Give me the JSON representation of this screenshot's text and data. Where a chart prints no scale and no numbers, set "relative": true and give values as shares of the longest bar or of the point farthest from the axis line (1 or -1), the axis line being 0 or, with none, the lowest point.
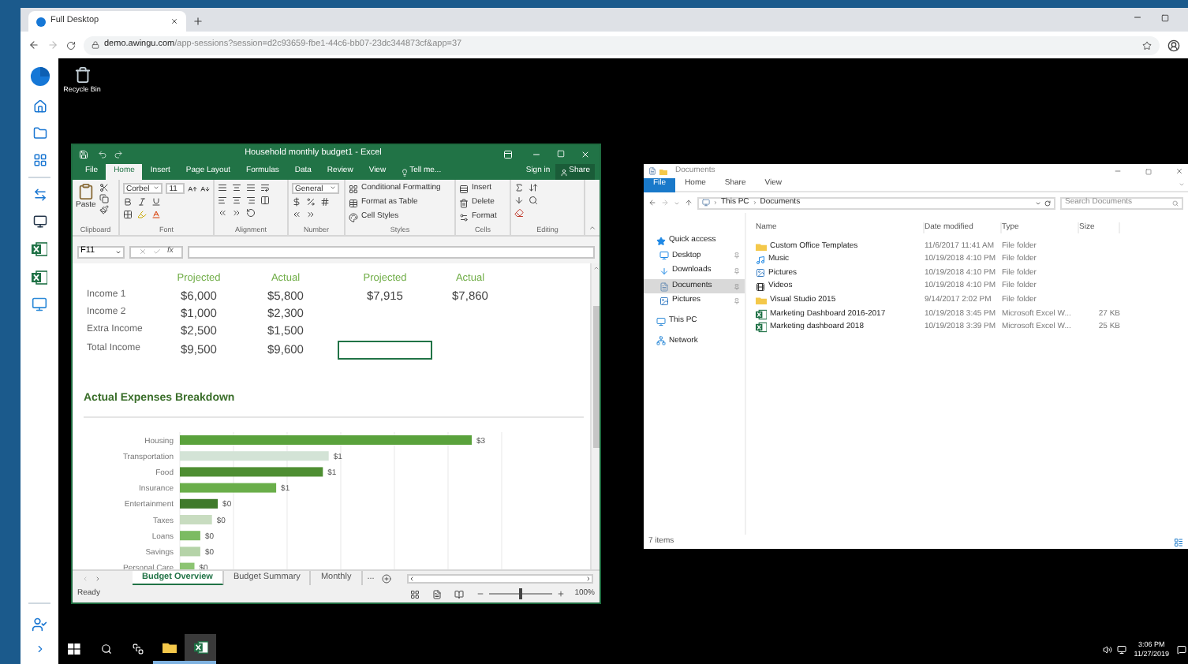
{
  "browser": {
    "tab": {
      "title": "Full Desktop",
      "selected": true
    },
    "url_domain": "demo.awingu.com",
    "url_path": "/app-sessions?session=d2c93659-fbe1-44c6-bb07-23dc344873cf&app=37"
  },
  "desktop": {
    "icons": [
      {
        "label": "Recycle Bin"
      }
    ]
  },
  "excel": {
    "title": "Household monthly budget1 - Excel",
    "tabs": [
      {
        "label": "File",
        "selected": false
      },
      {
        "label": "Home",
        "selected": true
      },
      {
        "label": "Insert",
        "selected": false
      },
      {
        "label": "Page Layout",
        "selected": false
      },
      {
        "label": "Formulas",
        "selected": false
      },
      {
        "label": "Data",
        "selected": false
      },
      {
        "label": "Review",
        "selected": false
      },
      {
        "label": "View",
        "selected": false
      }
    ],
    "tell_me": "Tell me...",
    "sign_in": "Sign in",
    "share": "Share",
    "ribbon": {
      "paste": "Paste",
      "font_name": "Corbel",
      "font_size": "11",
      "number_format": "General",
      "styles": [
        "Conditional Formatting",
        "Format as Table",
        "Cell Styles"
      ],
      "cells": [
        "Insert",
        "Delete",
        "Format"
      ],
      "groups": [
        "Clipboard",
        "Font",
        "Alignment",
        "Number",
        "Styles",
        "Cells",
        "Editing"
      ]
    },
    "name_box": "F11",
    "fx": "fx",
    "sheet": {
      "headers": [
        "Projected",
        "Actual",
        "Projected",
        "Actual"
      ],
      "rows": [
        {
          "label": "Income 1",
          "cells": [
            "$6,000",
            "$5,800",
            "$7,915",
            "$7,860"
          ]
        },
        {
          "label": "Income 2",
          "cells": [
            "$1,000",
            "$2,300"
          ]
        },
        {
          "label": "Extra Income",
          "cells": [
            "$2,500",
            "$1,500"
          ]
        },
        {
          "label": "Total Income",
          "cells": [
            "$9,500",
            "$9,600"
          ]
        }
      ],
      "section_title": "Actual Expenses Breakdown",
      "chart_data": {
        "type": "bar",
        "orientation": "horizontal",
        "relative": true,
        "categories": [
          "Housing",
          "Transportation",
          "Food",
          "Insurance",
          "Entertainment",
          "Taxes",
          "Loans",
          "Savings",
          "Personal Care"
        ],
        "series": [
          {
            "values": [
              1,
              0.51,
              0.49,
              0.33,
              0.13,
              0.11,
              0.07,
              0.07,
              0.05
            ]
          }
        ],
        "value_labels": [
          "$3",
          "$1",
          "$1",
          "$1",
          "$0",
          "$0",
          "$0",
          "$0",
          "$0"
        ]
      }
    },
    "sheet_tabs": [
      {
        "label": "Budget Overview",
        "selected": true
      },
      {
        "label": "Budget Summary",
        "selected": false
      },
      {
        "label": "Monthly",
        "selected": false
      }
    ],
    "more_tabs": "...",
    "status": "Ready",
    "zoom": {
      "level": 0.5,
      "reading": "100%"
    }
  },
  "explorer": {
    "title": "Documents",
    "tabs": [
      {
        "label": "File",
        "selected": true
      },
      {
        "label": "Home",
        "selected": false
      },
      {
        "label": "Share",
        "selected": false
      },
      {
        "label": "View",
        "selected": false
      }
    ],
    "breadcrumb": [
      "This PC",
      "Documents"
    ],
    "search": {
      "placeholder": "Search Documents"
    },
    "nav": [
      {
        "label": "Quick access",
        "kind": "star",
        "selected": false,
        "children": [
          {
            "label": "Desktop",
            "kind": "desktop",
            "selected": false,
            "pinned": true
          },
          {
            "label": "Downloads",
            "kind": "download",
            "selected": false,
            "pinned": true
          },
          {
            "label": "Documents",
            "kind": "documents",
            "selected": true,
            "pinned": true
          },
          {
            "label": "Pictures",
            "kind": "pictures",
            "selected": false,
            "pinned": true
          }
        ]
      },
      {
        "label": "This PC",
        "kind": "pc",
        "selected": false
      },
      {
        "label": "Network",
        "kind": "network",
        "selected": false
      }
    ],
    "columns": [
      "Name",
      "Date modified",
      "Type",
      "Size"
    ],
    "files": [
      {
        "name": "Custom Office Templates",
        "kind": "folder",
        "date": "11/6/2017 11:41 AM",
        "type": "File folder"
      },
      {
        "name": "Music",
        "kind": "music",
        "date": "10/19/2018 4:10 PM",
        "type": "File folder"
      },
      {
        "name": "Pictures",
        "kind": "pictures",
        "date": "10/19/2018 4:10 PM",
        "type": "File folder"
      },
      {
        "name": "Videos",
        "kind": "videos",
        "date": "10/19/2018 4:10 PM",
        "type": "File folder"
      },
      {
        "name": "Visual Studio 2015",
        "kind": "folder",
        "date": "9/14/2017 2:02 PM",
        "type": "File folder"
      },
      {
        "name": "Marketing Dashboard 2016-2017",
        "kind": "excel",
        "date": "10/19/2018 3:45 PM",
        "type": "Microsoft Excel W...",
        "size": "27 KB"
      },
      {
        "name": "Marketing dashboard 2018",
        "kind": "excel",
        "date": "10/19/2018 3:39 PM",
        "type": "Microsoft Excel W...",
        "size": "25 KB"
      }
    ],
    "status": "7 items"
  },
  "taskbar": {
    "apps": [
      {
        "kind": "explorer",
        "active": false
      },
      {
        "kind": "excel",
        "active": true
      }
    ],
    "time": "3:06 PM",
    "date": "11/27/2019"
  }
}
